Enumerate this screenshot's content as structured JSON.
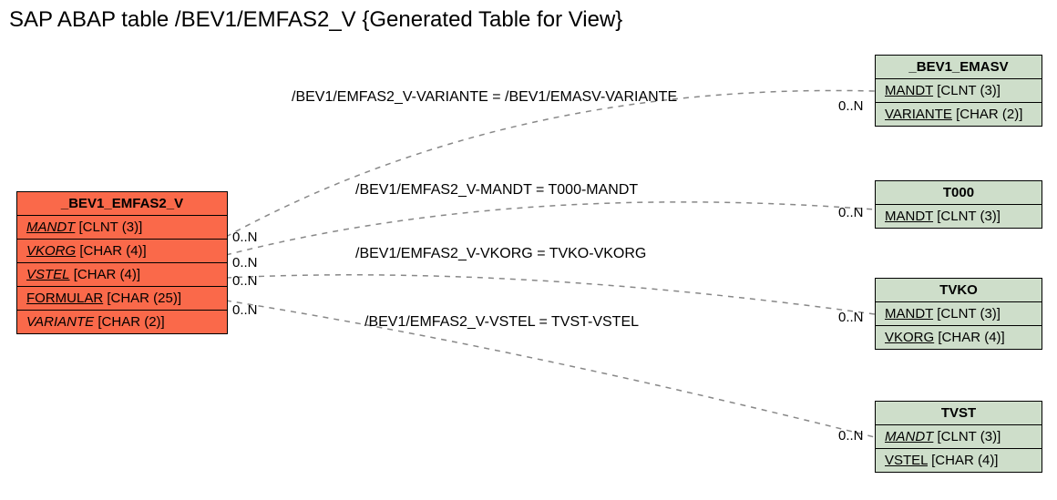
{
  "title": "SAP ABAP table /BEV1/EMFAS2_V {Generated Table for View}",
  "mainEntity": {
    "name": "_BEV1_EMFAS2_V",
    "fields": [
      {
        "label": "MANDT",
        "type": "[CLNT (3)]",
        "underline": true,
        "italic": true
      },
      {
        "label": "VKORG",
        "type": "[CHAR (4)]",
        "underline": true,
        "italic": true
      },
      {
        "label": "VSTEL",
        "type": "[CHAR (4)]",
        "underline": true,
        "italic": true
      },
      {
        "label": "FORMULAR",
        "type": "[CHAR (25)]",
        "underline": true,
        "italic": false
      },
      {
        "label": "VARIANTE",
        "type": "[CHAR (2)]",
        "underline": false,
        "italic": true
      }
    ]
  },
  "refEntities": [
    {
      "name": "_BEV1_EMASV",
      "fields": [
        {
          "label": "MANDT",
          "type": "[CLNT (3)]",
          "underline": true,
          "italic": false
        },
        {
          "label": "VARIANTE",
          "type": "[CHAR (2)]",
          "underline": true,
          "italic": false
        }
      ]
    },
    {
      "name": "T000",
      "fields": [
        {
          "label": "MANDT",
          "type": "[CLNT (3)]",
          "underline": true,
          "italic": false
        }
      ]
    },
    {
      "name": "TVKO",
      "fields": [
        {
          "label": "MANDT",
          "type": "[CLNT (3)]",
          "underline": true,
          "italic": false
        },
        {
          "label": "VKORG",
          "type": "[CHAR (4)]",
          "underline": true,
          "italic": false
        }
      ]
    },
    {
      "name": "TVST",
      "fields": [
        {
          "label": "MANDT",
          "type": "[CLNT (3)]",
          "underline": true,
          "italic": true
        },
        {
          "label": "VSTEL",
          "type": "[CHAR (4)]",
          "underline": true,
          "italic": false
        }
      ]
    }
  ],
  "relations": [
    {
      "label": "/BEV1/EMFAS2_V-VARIANTE = /BEV1/EMASV-VARIANTE",
      "leftCard": "0..N",
      "rightCard": "0..N"
    },
    {
      "label": "/BEV1/EMFAS2_V-MANDT = T000-MANDT",
      "leftCard": "0..N",
      "rightCard": "0..N"
    },
    {
      "label": "/BEV1/EMFAS2_V-VKORG = TVKO-VKORG",
      "leftCard": "0..N",
      "rightCard": "0..N"
    },
    {
      "label": "/BEV1/EMFAS2_V-VSTEL = TVST-VSTEL",
      "leftCard": "0..N",
      "rightCard": "0..N"
    }
  ]
}
